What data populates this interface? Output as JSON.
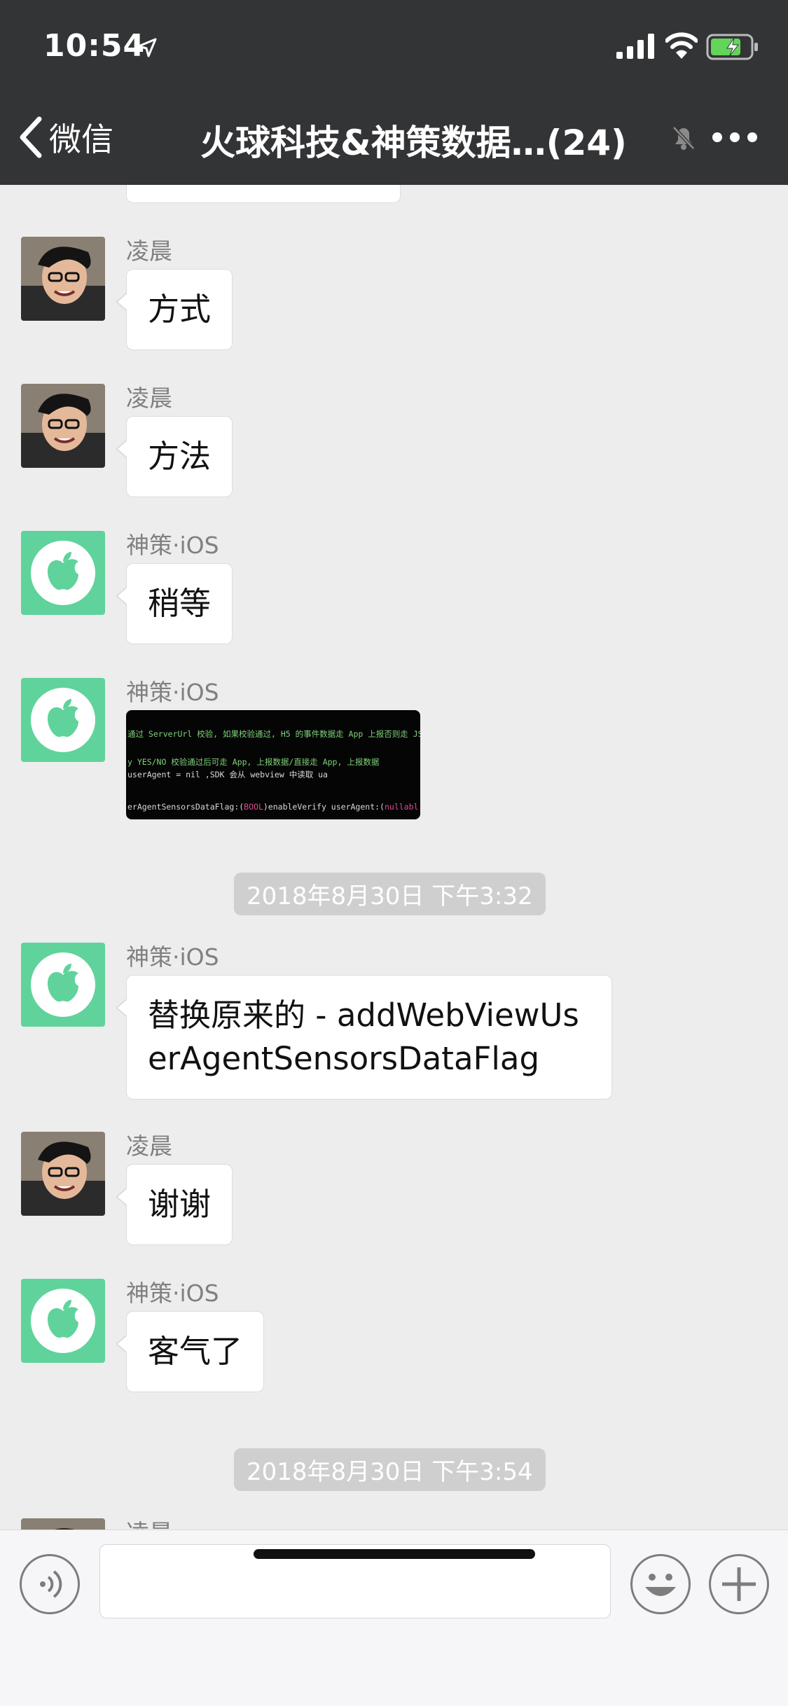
{
  "status_bar": {
    "time": "10:54"
  },
  "nav": {
    "back_label": "微信",
    "title": "火球科技&神策数据…(24)"
  },
  "messages": [
    {
      "sender": "凌晨",
      "text": "方式"
    },
    {
      "sender": "凌晨",
      "text": "方法"
    },
    {
      "sender": "神策·iOS",
      "text": "稍等"
    },
    {
      "sender": "神策·iOS",
      "image_lines": [
        "通过 ServerUrl 校验, 如果校验通过, H5 的事件数据走 App 上报否则走 JS",
        "y YES/NO   校验通过后可走 App, 上报数据/直接走 App, 上报数据",
        "userAgent = nil ,SDK 会从 webview 中读取 ua",
        "erAgentSensorsDataFlag:(",
        "BOOL",
        ")enableVerify userAgent:(",
        "nullabl"
      ]
    },
    {
      "sender": "神策·iOS",
      "text": "替换原来的 - addWebViewUserAgentSensorsDataFlag"
    },
    {
      "sender": "凌晨",
      "text": "谢谢"
    },
    {
      "sender": "神策·iOS",
      "text": "客气了"
    },
    {
      "sender": "凌晨"
    }
  ],
  "timestamps": [
    "2018年8月30日 下午3:32",
    "2018年8月30日 下午3:54"
  ],
  "input_bar": {
    "text_value": ""
  },
  "colors": {
    "header_bg": "#333436",
    "chat_bg": "#ededed",
    "timestamp_bg": "#cfcfcf",
    "ios_avatar": "#5fd39b"
  }
}
